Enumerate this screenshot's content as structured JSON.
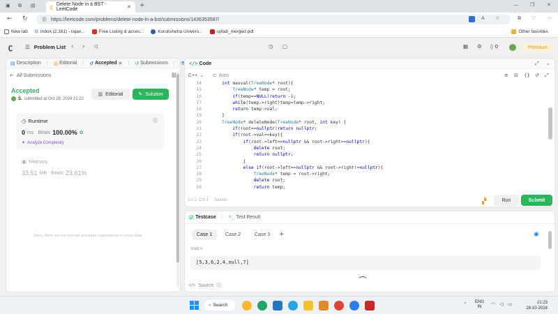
{
  "browser": {
    "tab_title": "Delete Node in a BST - LeetCode",
    "url": "https://leetcode.com/problems/delete-node-in-a-bst/submissions/1436353587/",
    "bookmarks": [
      "New tab",
      "Inbox (2,161) - rajan...",
      "Free Listing & acces...",
      "Kurukshetra Univers...",
      "syllab_merged.pdf"
    ],
    "other_favorites": "Other favorites"
  },
  "nav": {
    "problem_list": "Problem List",
    "coin_count": "0",
    "premium": "Premium"
  },
  "left_panel": {
    "tabs": [
      "Description",
      "Editorial",
      "Accepted",
      "Submissions",
      "S"
    ],
    "back_label": "All Submissions",
    "status": "Accepted",
    "submitted_by": "S.",
    "submitted_at": "submitted at Oct 28, 2024 21:22",
    "editorial_btn": "Editorial",
    "solution_btn": "Solution",
    "runtime_label": "Runtime",
    "runtime_value": "0",
    "runtime_unit": "ms",
    "beats_label": "Beats",
    "runtime_beats": "100.00%",
    "analyze": "Analyze Complexity",
    "memory_label": "Memory",
    "memory_value": "33.51",
    "memory_unit": "MB",
    "memory_beats": "23.61%",
    "no_data": "Sorry, there are not enough accepted submissions to show data"
  },
  "editor": {
    "title": "Code",
    "language": "C++",
    "mode": "Auto",
    "status_line": "Ln 1, Col 1",
    "saved": "Saved",
    "run": "Run",
    "submit": "Submit",
    "lines": [
      {
        "n": "14",
        "t": "    int maxval(TreeNode* root){"
      },
      {
        "n": "15",
        "t": "        TreeNode* temp = root;"
      },
      {
        "n": "16",
        "t": "        if(temp==NULL)return -1;"
      },
      {
        "n": "17",
        "t": "        while(temp->right)temp=temp->right;"
      },
      {
        "n": "18",
        "t": "        return temp->val;"
      },
      {
        "n": "19",
        "t": "    }"
      },
      {
        "n": "20",
        "t": "    TreeNode* deleteNode(TreeNode* root, int key) {"
      },
      {
        "n": "21",
        "t": "        if(root==nullptr)return nullptr;"
      },
      {
        "n": "22",
        "t": "        if(root->val==key){"
      },
      {
        "n": "23",
        "t": "            if(root->left==nullptr && root->right==nullptr){"
      },
      {
        "n": "24",
        "t": "                delete root;"
      },
      {
        "n": "25",
        "t": "                return nullptr;"
      },
      {
        "n": "26",
        "t": "            }"
      },
      {
        "n": "27",
        "t": "            else if(root->left==nullptr && root->right!=nullptr){"
      },
      {
        "n": "28",
        "t": "                TreeNode* temp = root->right;"
      },
      {
        "n": "29",
        "t": "                delete root;"
      },
      {
        "n": "30",
        "t": "                return temp;"
      }
    ]
  },
  "testcase": {
    "tab": "Testcase",
    "result_tab": "Test Result",
    "cases": [
      "Case 1",
      "Case 2",
      "Case 3"
    ],
    "param": "root =",
    "value": "[5,3,6,2,4,null,7]",
    "source": "Source"
  },
  "taskbar": {
    "search": "Search",
    "lang1": "ENG",
    "lang2": "IN",
    "time": "21:23",
    "date": "28-10-2024"
  }
}
